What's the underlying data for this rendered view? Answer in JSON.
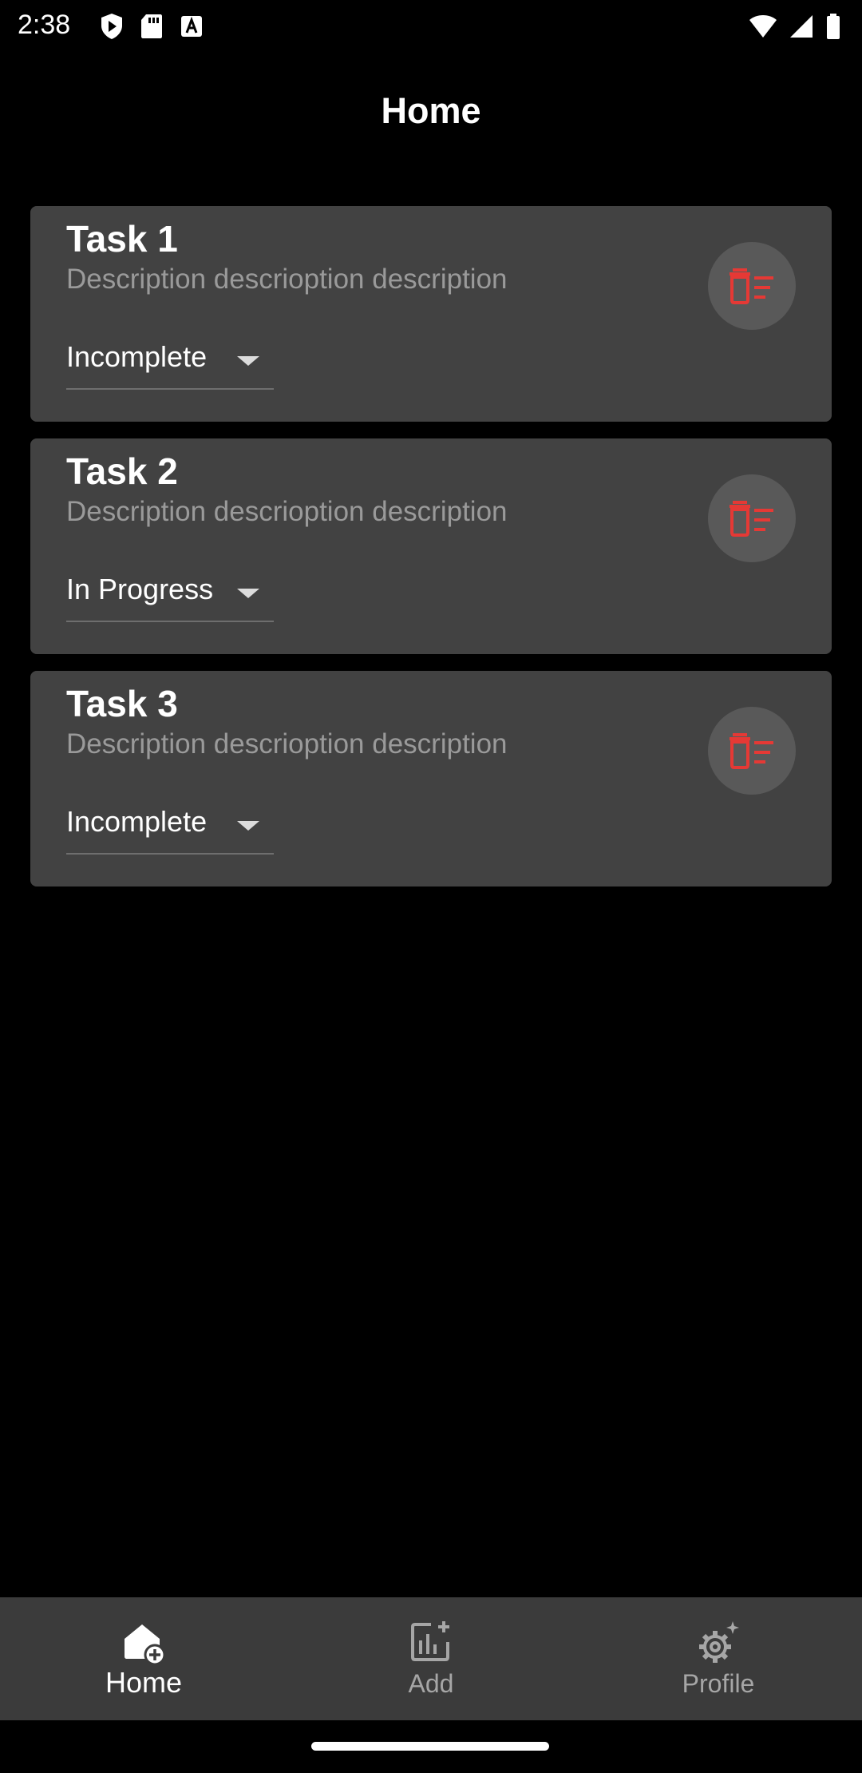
{
  "status_bar": {
    "time": "2:38",
    "left_icons": [
      "shield-play-icon",
      "sd-card-icon",
      "keyboard-a-icon"
    ],
    "right_icons": [
      "wifi-icon",
      "cellular-signal-icon",
      "battery-icon"
    ]
  },
  "header": {
    "title": "Home"
  },
  "tasks": [
    {
      "title": "Task 1",
      "description": "Description descrioption description",
      "status": "Incomplete"
    },
    {
      "title": "Task 2",
      "description": "Description descrioption description",
      "status": "In Progress"
    },
    {
      "title": "Task 3",
      "description": "Description descrioption description",
      "status": "Incomplete"
    }
  ],
  "task_actions": {
    "delete_icon": "delete-sweep-icon",
    "delete_color": "#e53935"
  },
  "bottom_nav": {
    "items": [
      {
        "label": "Home",
        "icon": "home-add-icon",
        "active": true
      },
      {
        "label": "Add",
        "icon": "add-chart-icon",
        "active": false
      },
      {
        "label": "Profile",
        "icon": "settings-sparkle-icon",
        "active": false
      }
    ]
  },
  "colors": {
    "background": "#000000",
    "card": "#424242",
    "nav_bar": "#3b3b3b",
    "accent_delete": "#e53935"
  }
}
